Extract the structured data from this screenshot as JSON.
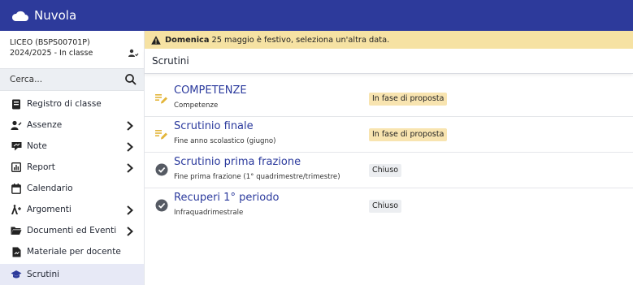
{
  "app": {
    "name": "Nuvola"
  },
  "sidebar": {
    "school": "LICEO (BSPS00701P)",
    "year_class": "2024/2025 - In classe",
    "search_placeholder": "Cerca...",
    "items": [
      {
        "label": "Registro di classe",
        "icon": "register-icon",
        "has_chevron": false,
        "active": false
      },
      {
        "label": "Assenze",
        "icon": "absences-icon",
        "has_chevron": true,
        "active": false
      },
      {
        "label": "Note",
        "icon": "notes-icon",
        "has_chevron": true,
        "active": false
      },
      {
        "label": "Report",
        "icon": "report-icon",
        "has_chevron": true,
        "active": false
      },
      {
        "label": "Calendario",
        "icon": "calendar-icon",
        "has_chevron": false,
        "active": false
      },
      {
        "label": "Argomenti",
        "icon": "topics-icon",
        "has_chevron": true,
        "active": false
      },
      {
        "label": "Documenti ed Eventi",
        "icon": "folder-icon",
        "has_chevron": true,
        "active": false
      },
      {
        "label": "Materiale per docente",
        "icon": "material-icon",
        "has_chevron": false,
        "active": false
      },
      {
        "label": "Scrutini",
        "icon": "graduation-cap-icon",
        "has_chevron": false,
        "active": true
      }
    ]
  },
  "alert": {
    "day": "Domenica",
    "message": "25 maggio è festivo, seleziona un'altra data."
  },
  "page": {
    "title": "Scrutini"
  },
  "scrutini": [
    {
      "title": "COMPETENZE",
      "subtitle": "Competenze",
      "status": "In fase di proposta",
      "state": "proposal"
    },
    {
      "title": "Scrutinio finale",
      "subtitle": "Fine anno scolastico (giugno)",
      "status": "In fase di proposta",
      "state": "proposal"
    },
    {
      "title": "Scrutinio prima frazione",
      "subtitle": "Fine prima frazione (1° quadrimestre/trimestre)",
      "status": "Chiuso",
      "state": "closed"
    },
    {
      "title": "Recuperi 1° periodo",
      "subtitle": "Infraquadrimestrale",
      "status": "Chiuso",
      "state": "closed"
    }
  ],
  "colors": {
    "topbar": "#2d3a9b",
    "accent_text": "#2b3a9d",
    "alert_bg": "#f6e2a3",
    "proposal_badge": "#f8e4b0",
    "closed_badge": "#eceef1",
    "pencil_yellow": "#e3b53a"
  }
}
